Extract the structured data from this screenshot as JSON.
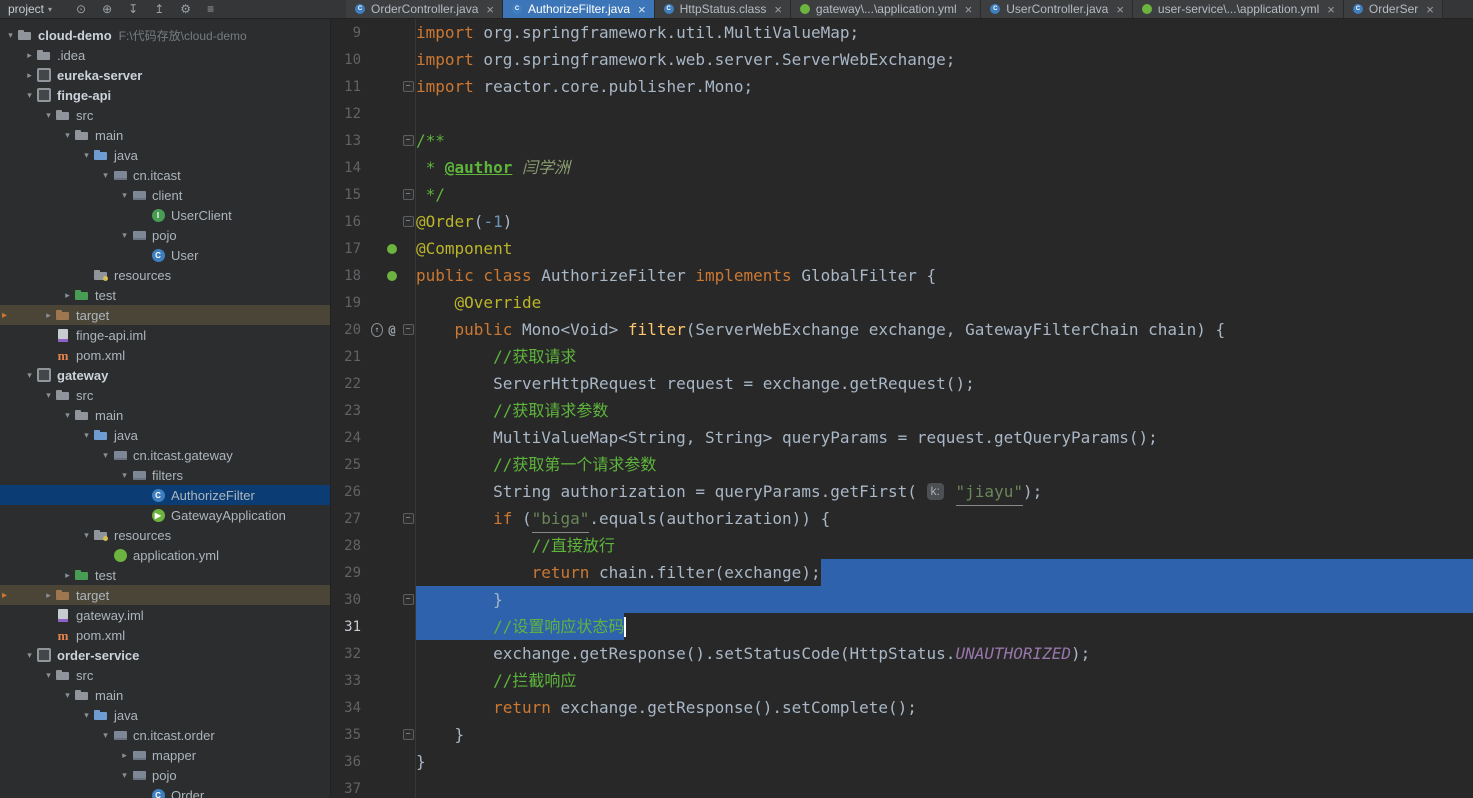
{
  "topbar": {
    "project_label": "project",
    "dropdown_glyph": "▾",
    "icons": [
      {
        "name": "locate-icon",
        "glyph": "⊙"
      },
      {
        "name": "expand-all-icon",
        "glyph": "⊕"
      },
      {
        "name": "collapse-all-icon",
        "glyph": "↧"
      },
      {
        "name": "scroll-to-source-icon",
        "glyph": "↥"
      },
      {
        "name": "settings-icon",
        "glyph": "⚙"
      },
      {
        "name": "menu-icon",
        "glyph": "≡"
      }
    ]
  },
  "tabs": [
    {
      "label": "OrderController.java",
      "icon": "class-icon",
      "close_glyph": "×",
      "active": false
    },
    {
      "label": "AuthorizeFilter.java",
      "icon": "class-icon",
      "close_glyph": "×",
      "active": true
    },
    {
      "label": "HttpStatus.class",
      "icon": "class-icon",
      "close_glyph": "×",
      "active": false
    },
    {
      "label": "gateway\\...\\application.yml",
      "icon": "spring-config-icon",
      "close_glyph": "×",
      "active": false
    },
    {
      "label": "UserController.java",
      "icon": "class-icon",
      "close_glyph": "×",
      "active": false
    },
    {
      "label": "user-service\\...\\application.yml",
      "icon": "spring-config-icon",
      "close_glyph": "×",
      "active": false
    },
    {
      "label": "OrderSer",
      "icon": "class-icon",
      "close_glyph": "×",
      "active": false
    }
  ],
  "project_tree": {
    "rows": [
      {
        "label": "cloud-demo",
        "suffix": "F:\\代码存放\\cloud-demo",
        "level": 0,
        "icon": "project-folder-icon",
        "chevron": "expanded",
        "bold": true
      },
      {
        "label": ".idea",
        "level": 1,
        "icon": "idea-folder-icon",
        "chevron": "collapsed"
      },
      {
        "label": "eureka-server",
        "level": 1,
        "icon": "module-icon",
        "chevron": "collapsed",
        "bold": true
      },
      {
        "label": "finge-api",
        "level": 1,
        "icon": "module-icon",
        "chevron": "expanded",
        "bold": true
      },
      {
        "label": "src",
        "level": 2,
        "icon": "folder-icon",
        "chevron": "expanded"
      },
      {
        "label": "main",
        "level": 3,
        "icon": "folder-icon",
        "chevron": "expanded"
      },
      {
        "label": "java",
        "level": 4,
        "icon": "source-folder-icon",
        "chevron": "expanded"
      },
      {
        "label": "cn.itcast",
        "level": 5,
        "icon": "package-icon",
        "chevron": "expanded"
      },
      {
        "label": "client",
        "level": 6,
        "icon": "package-icon",
        "chevron": "expanded"
      },
      {
        "label": "UserClient",
        "level": 7,
        "icon": "interface-icon",
        "chevron": "none"
      },
      {
        "label": "pojo",
        "level": 6,
        "icon": "package-icon",
        "chevron": "expanded"
      },
      {
        "label": "User",
        "level": 7,
        "icon": "class-icon",
        "chevron": "none"
      },
      {
        "label": "resources",
        "level": 4,
        "icon": "resources-folder-icon",
        "chevron": "none"
      },
      {
        "label": "test",
        "level": 3,
        "icon": "test-folder-icon",
        "chevron": "collapsed"
      },
      {
        "label": "target",
        "level": 2,
        "icon": "excluded-folder-icon",
        "chevron": "collapsed",
        "highlighted": true
      },
      {
        "label": "finge-api.iml",
        "level": 2,
        "icon": "iml-file-icon",
        "chevron": "none"
      },
      {
        "label": "pom.xml",
        "level": 2,
        "icon": "maven-file-icon",
        "chevron": "none"
      },
      {
        "label": "gateway",
        "level": 1,
        "icon": "module-icon",
        "chevron": "expanded",
        "bold": true
      },
      {
        "label": "src",
        "level": 2,
        "icon": "folder-icon",
        "chevron": "expanded"
      },
      {
        "label": "main",
        "level": 3,
        "icon": "folder-icon",
        "chevron": "expanded"
      },
      {
        "label": "java",
        "level": 4,
        "icon": "source-folder-icon",
        "chevron": "expanded"
      },
      {
        "label": "cn.itcast.gateway",
        "level": 5,
        "icon": "package-icon",
        "chevron": "expanded"
      },
      {
        "label": "filters",
        "level": 6,
        "icon": "package-icon",
        "chevron": "expanded"
      },
      {
        "label": "AuthorizeFilter",
        "level": 7,
        "icon": "class-icon",
        "chevron": "none",
        "selected": true
      },
      {
        "label": "GatewayApplication",
        "level": 7,
        "icon": "spring-boot-icon",
        "chevron": "none"
      },
      {
        "label": "resources",
        "level": 4,
        "icon": "resources-folder-icon",
        "chevron": "expanded"
      },
      {
        "label": "application.yml",
        "level": 5,
        "icon": "spring-config-icon",
        "chevron": "none"
      },
      {
        "label": "test",
        "level": 3,
        "icon": "test-folder-icon",
        "chevron": "collapsed"
      },
      {
        "label": "target",
        "level": 2,
        "icon": "excluded-folder-icon",
        "chevron": "collapsed",
        "highlighted": true
      },
      {
        "label": "gateway.iml",
        "level": 2,
        "icon": "iml-file-icon",
        "chevron": "none"
      },
      {
        "label": "pom.xml",
        "level": 2,
        "icon": "maven-file-icon",
        "chevron": "none"
      },
      {
        "label": "order-service",
        "level": 1,
        "icon": "module-icon",
        "chevron": "expanded",
        "bold": true
      },
      {
        "label": "src",
        "level": 2,
        "icon": "folder-icon",
        "chevron": "expanded"
      },
      {
        "label": "main",
        "level": 3,
        "icon": "folder-icon",
        "chevron": "expanded"
      },
      {
        "label": "java",
        "level": 4,
        "icon": "source-folder-icon",
        "chevron": "expanded"
      },
      {
        "label": "cn.itcast.order",
        "level": 5,
        "icon": "package-icon",
        "chevron": "expanded"
      },
      {
        "label": "mapper",
        "level": 6,
        "icon": "package-icon",
        "chevron": "collapsed"
      },
      {
        "label": "pojo",
        "level": 6,
        "icon": "package-icon",
        "chevron": "expanded"
      },
      {
        "label": "Order",
        "level": 7,
        "icon": "class-icon",
        "chevron": "none"
      }
    ]
  },
  "editor": {
    "lines": [
      {
        "num": 9,
        "segs": [
          [
            "kw",
            "import"
          ],
          [
            "def",
            " org.springframework.util.MultiValueMap;"
          ]
        ]
      },
      {
        "num": 10,
        "segs": [
          [
            "kw",
            "import"
          ],
          [
            "def",
            " org.springframework.web.server.ServerWebExchange;"
          ]
        ]
      },
      {
        "num": 11,
        "segs": [
          [
            "kw",
            "import"
          ],
          [
            "def",
            " reactor.core.publisher.Mono;"
          ]
        ],
        "fold": true
      },
      {
        "num": 12,
        "segs": []
      },
      {
        "num": 13,
        "segs": [
          [
            "com",
            "/**"
          ]
        ],
        "fold": true
      },
      {
        "num": 14,
        "segs": [
          [
            "com",
            " * "
          ],
          [
            "comtag",
            "@author"
          ],
          [
            "comauthor",
            " 闫学洲"
          ]
        ]
      },
      {
        "num": 15,
        "segs": [
          [
            "com",
            " */"
          ]
        ],
        "fold": true
      },
      {
        "num": 16,
        "segs": [
          [
            "ann",
            "@Order"
          ],
          [
            "def",
            "("
          ],
          [
            "num",
            "-1"
          ],
          [
            "def",
            ")"
          ]
        ],
        "fold": true
      },
      {
        "num": 17,
        "segs": [
          [
            "ann",
            "@Component"
          ]
        ],
        "gutter": [
          "spring-bean-icon"
        ]
      },
      {
        "num": 18,
        "segs": [
          [
            "kw",
            "public class"
          ],
          [
            "def",
            " AuthorizeFilter "
          ],
          [
            "kw",
            "implements"
          ],
          [
            "def",
            " GlobalFilter {"
          ]
        ],
        "gutter": [
          "spring-bean-icon"
        ]
      },
      {
        "num": 19,
        "segs": [
          [
            "def",
            "    "
          ],
          [
            "ann",
            "@Override"
          ]
        ]
      },
      {
        "num": 20,
        "segs": [
          [
            "def",
            "    "
          ],
          [
            "kw",
            "public"
          ],
          [
            "def",
            " Mono<Void> "
          ],
          [
            "method",
            "filter"
          ],
          [
            "def",
            "(ServerWebExchange exchange, GatewayFilterChain chain) {"
          ]
        ],
        "gutter": [
          "implementing-icon",
          "annotation-icon"
        ],
        "fold": true
      },
      {
        "num": 21,
        "segs": [
          [
            "def",
            "        "
          ],
          [
            "com",
            "//获取请求"
          ]
        ]
      },
      {
        "num": 22,
        "segs": [
          [
            "def",
            "        ServerHttpRequest request = exchange.getRequest();"
          ]
        ]
      },
      {
        "num": 23,
        "segs": [
          [
            "def",
            "        "
          ],
          [
            "com",
            "//获取请求参数"
          ]
        ]
      },
      {
        "num": 24,
        "segs": [
          [
            "def",
            "        MultiValueMap<String, String> queryParams = request.getQueryParams();"
          ]
        ]
      },
      {
        "num": 25,
        "segs": [
          [
            "def",
            "        "
          ],
          [
            "com",
            "//获取第一个请求参数"
          ]
        ]
      },
      {
        "num": 26,
        "segs": [
          [
            "def",
            "        String authorization = queryParams.getFirst( "
          ],
          [
            "inlay",
            "k:"
          ],
          [
            "def",
            " "
          ],
          [
            "stru",
            "\"jiayu\""
          ],
          [
            "def",
            ");"
          ]
        ]
      },
      {
        "num": 27,
        "segs": [
          [
            "def",
            "        "
          ],
          [
            "kw",
            "if"
          ],
          [
            "def",
            " ("
          ],
          [
            "stru",
            "\"biga\""
          ],
          [
            "def",
            ".equals(authorization)) {"
          ]
        ],
        "fold": true
      },
      {
        "num": 28,
        "segs": [
          [
            "def",
            "            "
          ],
          [
            "com",
            "//直接放行"
          ]
        ]
      },
      {
        "num": 29,
        "segs": [
          [
            "def",
            "            "
          ],
          [
            "kw",
            "return"
          ],
          [
            "def",
            " chain.filter(exchange);"
          ]
        ],
        "sel": "trail"
      },
      {
        "num": 30,
        "segs": [
          [
            "def",
            "        }"
          ]
        ],
        "sel": "full",
        "fold": true
      },
      {
        "num": 31,
        "segs": [
          [
            "def",
            "        "
          ],
          [
            "com",
            "//设置响应状态码"
          ]
        ],
        "sel": "text",
        "caret": true,
        "current": true
      },
      {
        "num": 32,
        "segs": [
          [
            "def",
            "        exchange.getResponse().setStatusCode(HttpStatus."
          ],
          [
            "field",
            "UNAUTHORIZED"
          ],
          [
            "def",
            ");"
          ]
        ]
      },
      {
        "num": 33,
        "segs": [
          [
            "def",
            "        "
          ],
          [
            "com",
            "//拦截响应"
          ]
        ]
      },
      {
        "num": 34,
        "segs": [
          [
            "def",
            "        "
          ],
          [
            "kw",
            "return"
          ],
          [
            "def",
            " exchange.getResponse().setComplete();"
          ]
        ]
      },
      {
        "num": 35,
        "segs": [
          [
            "def",
            "    }"
          ]
        ],
        "fold": true
      },
      {
        "num": 36,
        "segs": [
          [
            "def",
            "}"
          ]
        ]
      },
      {
        "num": 37,
        "segs": []
      }
    ]
  },
  "icon_defs": {
    "project-folder-icon": {
      "t": "folder",
      "c": "#8f959b"
    },
    "idea-folder-icon": {
      "t": "folder",
      "c": "#8f959b"
    },
    "folder-icon": {
      "t": "folder",
      "c": "#8f959b"
    },
    "source-folder-icon": {
      "t": "folder",
      "c": "#6d9dd1"
    },
    "resources-folder-icon": {
      "t": "folder",
      "c": "#8f959b",
      "dot": "#d6bf55"
    },
    "test-folder-icon": {
      "t": "folder",
      "c": "#499c54"
    },
    "excluded-folder-icon": {
      "t": "folder",
      "c": "#9e7650"
    },
    "module-icon": {
      "t": "mod"
    },
    "package-icon": {
      "t": "pkg"
    },
    "class-icon": {
      "t": "circ",
      "c": "#3f7fbf",
      "l": "C"
    },
    "interface-icon": {
      "t": "circ",
      "c": "#499c54",
      "l": "I"
    },
    "spring-boot-icon": {
      "t": "circ",
      "c": "#6db33f",
      "l": "▶"
    },
    "spring-config-icon": {
      "t": "circ",
      "c": "#6db33f",
      "l": ""
    },
    "iml-file-icon": {
      "t": "doc"
    },
    "maven-file-icon": {
      "t": "letter",
      "c": "#e8844a",
      "l": "m"
    },
    "spring-bean-icon": {
      "t": "circ",
      "c": "#6db33f",
      "l": ""
    },
    "implementing-icon": {
      "t": "glyph",
      "g": "↑",
      "cls": "g-override"
    },
    "annotation-icon": {
      "t": "glyph",
      "g": "@",
      "cls": "g-at"
    }
  },
  "colors": {
    "selection": "#2e62ad",
    "tab_active": "#3c76b9",
    "tree_selection": "#0b3d74",
    "tree_excluded_row": "#4a4537",
    "keyword": "#cc7832",
    "comment": "#5eb53c",
    "string": "#6a8759",
    "annotation": "#bbb529",
    "number": "#6897bb",
    "static_field": "#9876aa"
  }
}
